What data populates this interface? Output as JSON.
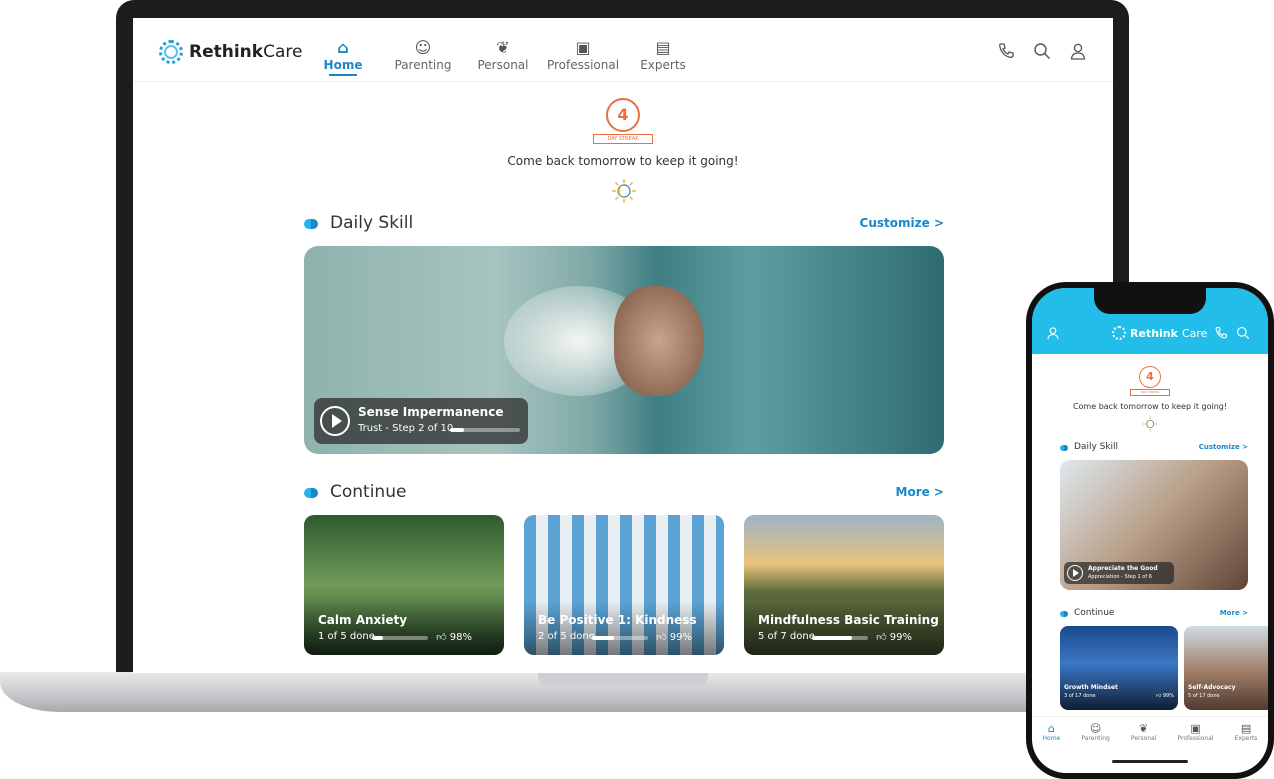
{
  "brand": {
    "name_bold": "Rethink",
    "name_light": "Care"
  },
  "colors": {
    "accent": "#1a87c9",
    "phone_header": "#22bde9",
    "streak": "#e8703e"
  },
  "nav": [
    {
      "label": "Home",
      "icon": "home-icon",
      "active": true
    },
    {
      "label": "Parenting",
      "icon": "parenting-icon"
    },
    {
      "label": "Personal",
      "icon": "leaf-icon"
    },
    {
      "label": "Professional",
      "icon": "briefcase-icon"
    },
    {
      "label": "Experts",
      "icon": "experts-icon"
    }
  ],
  "header_icons": [
    "phone-icon",
    "search-icon",
    "user-icon"
  ],
  "streak": {
    "days": "4",
    "ribbon": "DAY STREAK",
    "message": "Come back tomorrow to keep it going!"
  },
  "daily_skill": {
    "title": "Daily Skill",
    "link": "Customize >",
    "player": {
      "title": "Sense Impermanence",
      "subtitle": "Trust - Step 2 of 10",
      "progress": 0.2
    }
  },
  "continue": {
    "title": "Continue",
    "link": "More >",
    "cards": [
      {
        "title": "Calm Anxiety",
        "meta": "1 of 5 done",
        "progress": 0.2,
        "rating": "98%"
      },
      {
        "title": "Be Positive 1: Kindness",
        "meta": "2 of 5 done",
        "progress": 0.4,
        "rating": "99%"
      },
      {
        "title": "Mindfulness Basic Training",
        "meta": "5 of 7 done",
        "progress": 0.71,
        "rating": "99%"
      }
    ]
  },
  "phone": {
    "streak": {
      "days": "4",
      "ribbon": "DAY STREAK",
      "message": "Come back tomorrow to keep it going!"
    },
    "daily_skill": {
      "title": "Daily Skill",
      "link": "Customize >",
      "player": {
        "title": "Appreciate the Good",
        "subtitle": "Appreciation - Step 1 of 6",
        "progress": 0.17
      }
    },
    "continue": {
      "title": "Continue",
      "link": "More >",
      "cards": [
        {
          "title": "Growth Mindset",
          "meta": "3 of 17 done",
          "progress": 0.18,
          "rating": "99%"
        },
        {
          "title": "Self-Advocacy",
          "meta": "5 of 17 done",
          "progress": 0.29
        }
      ]
    },
    "tabs": [
      {
        "label": "Home",
        "active": true
      },
      {
        "label": "Parenting"
      },
      {
        "label": "Personal"
      },
      {
        "label": "Professional"
      },
      {
        "label": "Experts"
      }
    ]
  }
}
